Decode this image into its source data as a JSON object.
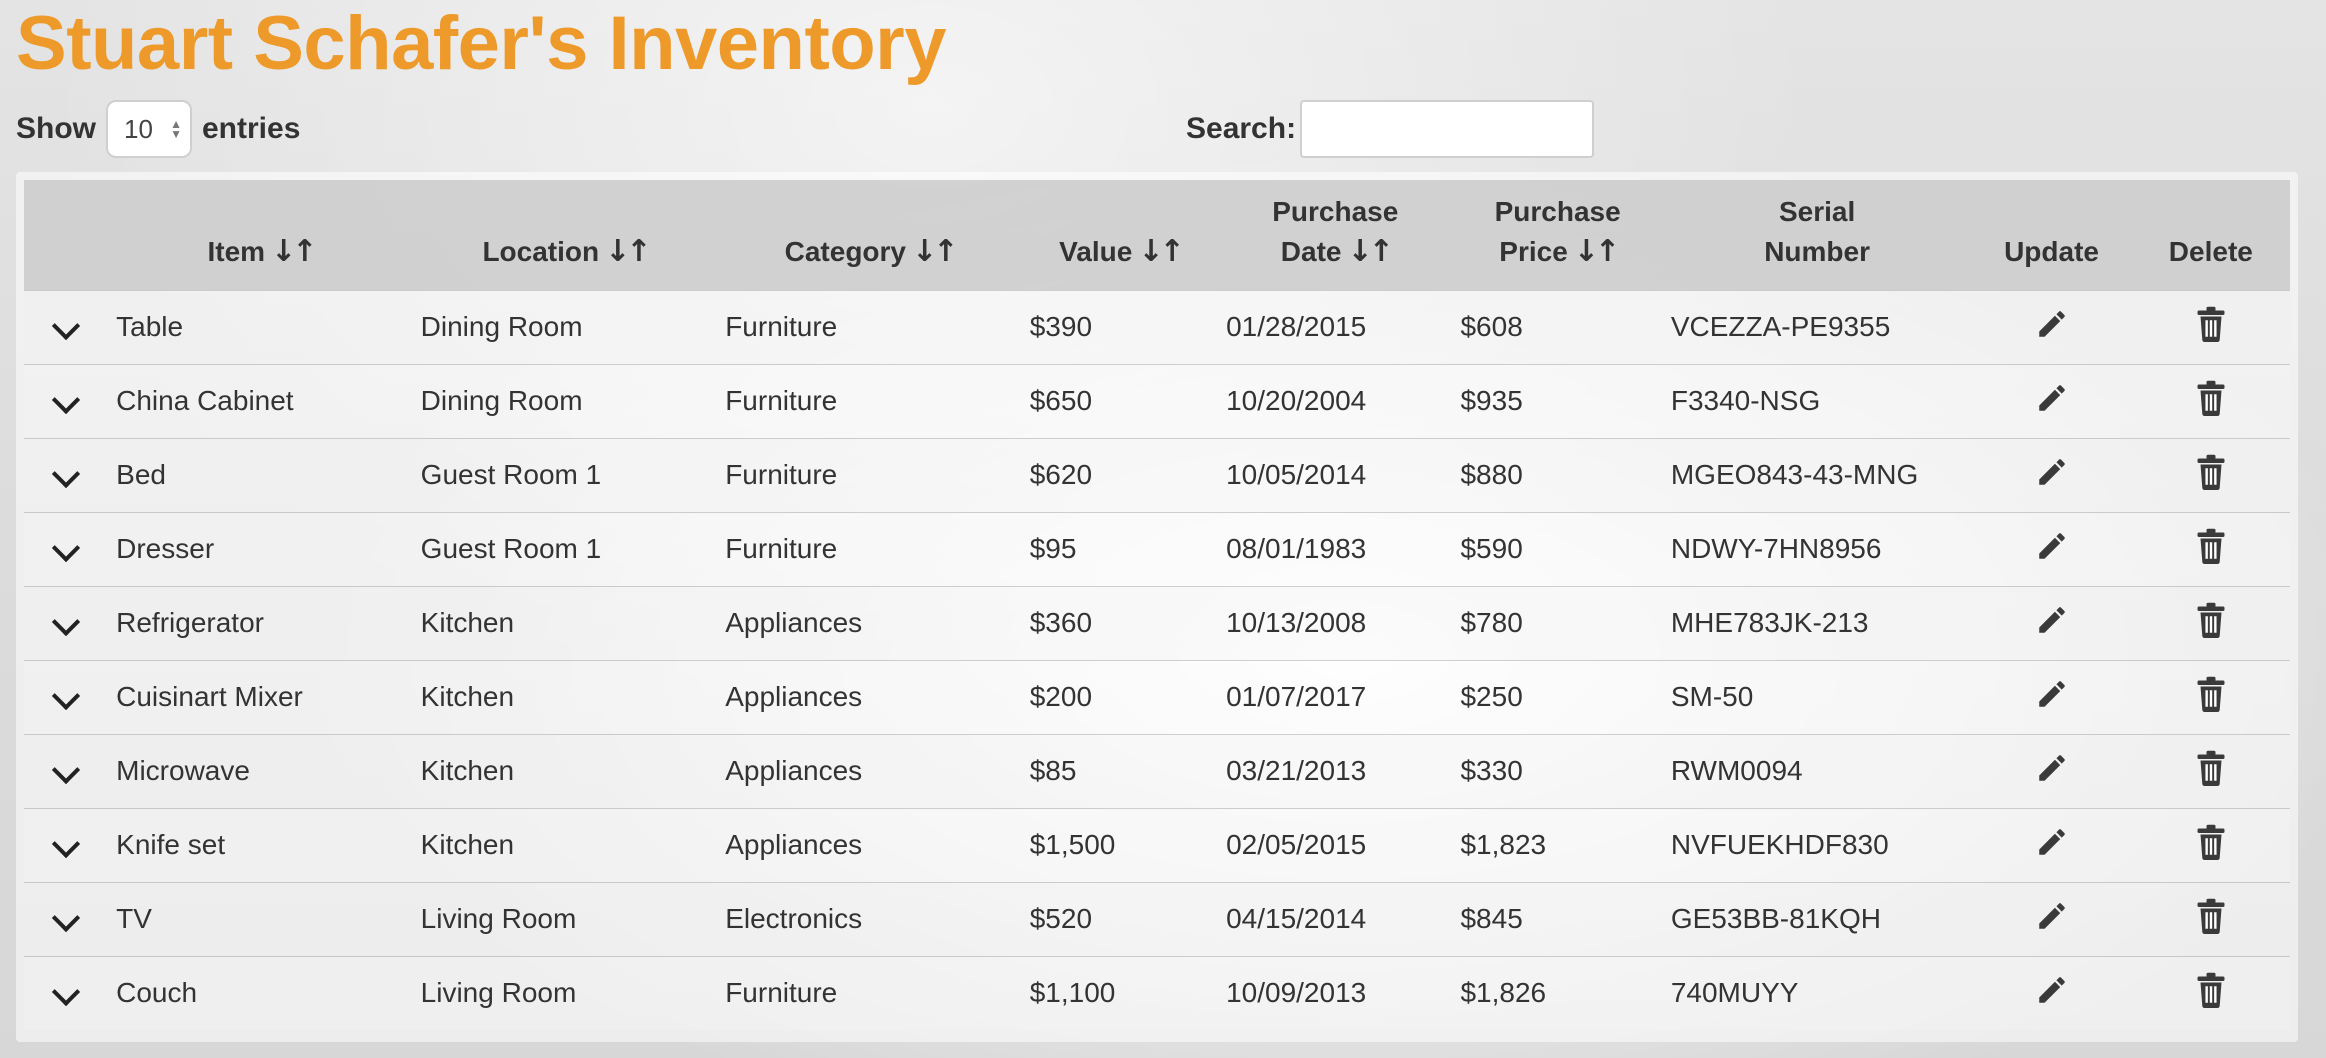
{
  "page": {
    "title": "Stuart Schafer's Inventory"
  },
  "length_control": {
    "show_label": "Show",
    "value": "10",
    "entries_label": "entries"
  },
  "search": {
    "label": "Search:",
    "value": "",
    "placeholder": ""
  },
  "table": {
    "columns": [
      {
        "label": "Item",
        "sortable": true
      },
      {
        "label": "Location",
        "sortable": true
      },
      {
        "label": "Category",
        "sortable": true
      },
      {
        "label": "Value",
        "sortable": true
      },
      {
        "label_line1": "Purchase",
        "label_line2": "Date",
        "sortable": true
      },
      {
        "label_line1": "Purchase",
        "label_line2": "Price",
        "sortable": true
      },
      {
        "label_line1": "Serial",
        "label_line2": "Number",
        "sortable": false
      },
      {
        "label": "Update",
        "sortable": false
      },
      {
        "label": "Delete",
        "sortable": false
      }
    ],
    "rows": [
      {
        "item": "Table",
        "location": "Dining Room",
        "category": "Furniture",
        "value": "$390",
        "purchase_date": "01/28/2015",
        "purchase_price": "$608",
        "serial": "VCEZZA-PE9355"
      },
      {
        "item": "China Cabinet",
        "location": "Dining Room",
        "category": "Furniture",
        "value": "$650",
        "purchase_date": "10/20/2004",
        "purchase_price": "$935",
        "serial": "F3340-NSG"
      },
      {
        "item": "Bed",
        "location": "Guest Room 1",
        "category": "Furniture",
        "value": "$620",
        "purchase_date": "10/05/2014",
        "purchase_price": "$880",
        "serial": "MGEO843-43-MNG"
      },
      {
        "item": "Dresser",
        "location": "Guest Room 1",
        "category": "Furniture",
        "value": "$95",
        "purchase_date": "08/01/1983",
        "purchase_price": "$590",
        "serial": "NDWY-7HN8956"
      },
      {
        "item": "Refrigerator",
        "location": "Kitchen",
        "category": "Appliances",
        "value": "$360",
        "purchase_date": "10/13/2008",
        "purchase_price": "$780",
        "serial": "MHE783JK-213"
      },
      {
        "item": "Cuisinart Mixer",
        "location": "Kitchen",
        "category": "Appliances",
        "value": "$200",
        "purchase_date": "01/07/2017",
        "purchase_price": "$250",
        "serial": "SM-50"
      },
      {
        "item": "Microwave",
        "location": "Kitchen",
        "category": "Appliances",
        "value": "$85",
        "purchase_date": "03/21/2013",
        "purchase_price": "$330",
        "serial": "RWM0094"
      },
      {
        "item": "Knife set",
        "location": "Kitchen",
        "category": "Appliances",
        "value": "$1,500",
        "purchase_date": "02/05/2015",
        "purchase_price": "$1,823",
        "serial": "NVFUEKHDF830"
      },
      {
        "item": "TV",
        "location": "Living Room",
        "category": "Electronics",
        "value": "$520",
        "purchase_date": "04/15/2014",
        "purchase_price": "$845",
        "serial": "GE53BB-81KQH"
      },
      {
        "item": "Couch",
        "location": "Living Room",
        "category": "Furniture",
        "value": "$1,100",
        "purchase_date": "10/09/2013",
        "purchase_price": "$1,826",
        "serial": "740MUYY"
      }
    ]
  },
  "icons": {
    "expand": "chevron-down-icon",
    "sort": "sort-icon",
    "update": "pencil-icon",
    "delete": "trash-icon"
  },
  "colors": {
    "title": "#ee9a2a",
    "header_bg": "#c4c4c4",
    "text": "#333333"
  }
}
